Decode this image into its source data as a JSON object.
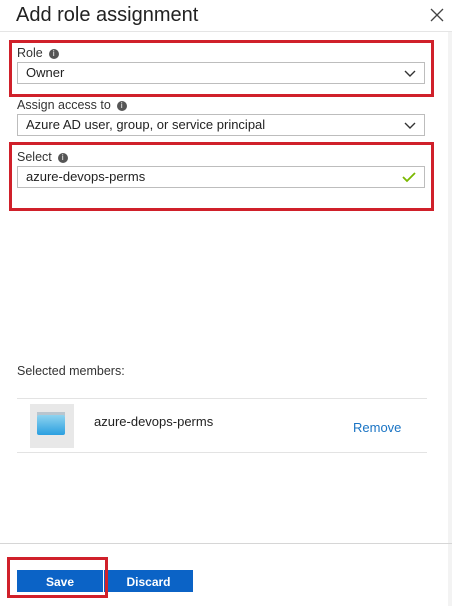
{
  "header": {
    "title": "Add role assignment"
  },
  "role": {
    "label": "Role",
    "value": "Owner"
  },
  "assign_access": {
    "label": "Assign access to",
    "value": "Azure AD user, group, or service principal"
  },
  "select": {
    "label": "Select",
    "value": "azure-devops-perms"
  },
  "members": {
    "heading": "Selected members:",
    "items": [
      {
        "name": "azure-devops-perms",
        "action": "Remove"
      }
    ]
  },
  "footer": {
    "save_label": "Save",
    "discard_label": "Discard"
  },
  "colors": {
    "accent": "#0b63c6",
    "link": "#1a74c4",
    "highlight": "#d0202a",
    "valid": "#7ab800"
  },
  "icons": {
    "close": "close-icon",
    "info": "info-icon",
    "chevron": "chevron-down-icon",
    "check": "checkmark-icon"
  }
}
